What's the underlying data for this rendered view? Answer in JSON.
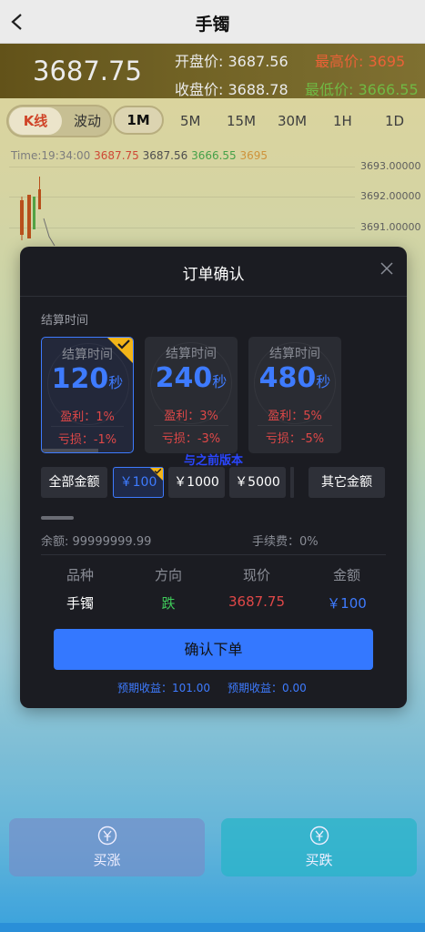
{
  "header": {
    "title": "手镯"
  },
  "price_bar": {
    "current": "3687.75",
    "open_label": "开盘价:",
    "open_value": "3687.56",
    "high_label": "最高价:",
    "high_value": "3695",
    "close_label": "收盘价:",
    "close_value": "3688.78",
    "low_label": "最低价:",
    "low_value": "3666.55"
  },
  "tabs": {
    "kline": "K线",
    "wave": "波动",
    "periods": [
      "1M",
      "5M",
      "15M",
      "30M",
      "1H",
      "1D"
    ],
    "active_period": "1M"
  },
  "chart": {
    "time_label": "Time:",
    "time_value": "19:34:00",
    "v1": "3687.75",
    "v2": "3687.56",
    "v3": "3666.55",
    "v4": "3695",
    "y_ticks": [
      "3693.00000",
      "3692.00000",
      "3691.00000"
    ]
  },
  "modal": {
    "title": "订单确认",
    "section_label": "结算时间",
    "time_cards": [
      {
        "header": "结算时间",
        "seconds": "120",
        "unit": "秒",
        "profit": "盈利：1%",
        "loss": "亏损：-1%",
        "selected": true
      },
      {
        "header": "结算时间",
        "seconds": "240",
        "unit": "秒",
        "profit": "盈利：3%",
        "loss": "亏损：-3%",
        "selected": false
      },
      {
        "header": "结算时间",
        "seconds": "480",
        "unit": "秒",
        "profit": "盈利：5%",
        "loss": "亏损：-5%",
        "selected": false
      }
    ],
    "link_text": "与之前版本",
    "amounts": {
      "all": "全部金额",
      "a1": "￥100",
      "a2": "￥1000",
      "a3": "￥5000",
      "other": "其它金额",
      "selected": "￥100"
    },
    "balance": "余额: 99999999.99",
    "fee": "手续费：0%",
    "table": {
      "headers": [
        "品种",
        "方向",
        "现价",
        "金额"
      ],
      "product": "手镯",
      "direction": "跌",
      "price": "3687.75",
      "amount": "￥100"
    },
    "confirm_label": "确认下单",
    "expected_1": "预期收益：101.00",
    "expected_2": "预期收益：0.00"
  },
  "actions": {
    "buy_up": "买涨",
    "buy_down": "买跌",
    "buy_up_icon": "yen-icon",
    "buy_down_icon": "yen-icon"
  },
  "colors": {
    "accent": "#3e7bff",
    "up_red": "#e04848",
    "down_green": "#3fca5a",
    "badge_gold": "#f2b418"
  }
}
